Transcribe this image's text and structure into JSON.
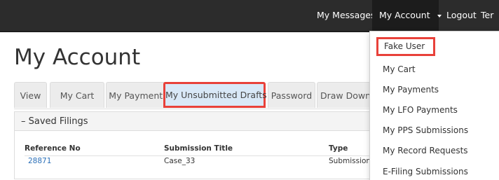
{
  "topnav": {
    "messages": "My Messages",
    "account": "My Account",
    "logout": "Logout",
    "cutoff": "Ter"
  },
  "page": {
    "title": "My Account"
  },
  "tabs": [
    "View",
    "My Cart",
    "My Payments",
    "My Unsubmitted Drafts",
    "Password",
    "Draw Down"
  ],
  "panel": {
    "heading": "– Saved Filings",
    "columns": [
      "Reference No",
      "Submission Title",
      "Type"
    ],
    "rows": [
      {
        "ref": "28871",
        "title": "Case_33",
        "type": "Submission"
      }
    ]
  },
  "dropdown": {
    "items": [
      "Fake User",
      "My Cart",
      "My Payments",
      "My LFO Payments",
      "My PPS Submissions",
      "My Record Requests",
      "E-Filing Submissions"
    ]
  },
  "colors": {
    "navbar": "#2c2c2c",
    "highlight_border": "#e8413a",
    "link": "#2a6fb8",
    "active_tab_bg": "#d9e8f7"
  }
}
